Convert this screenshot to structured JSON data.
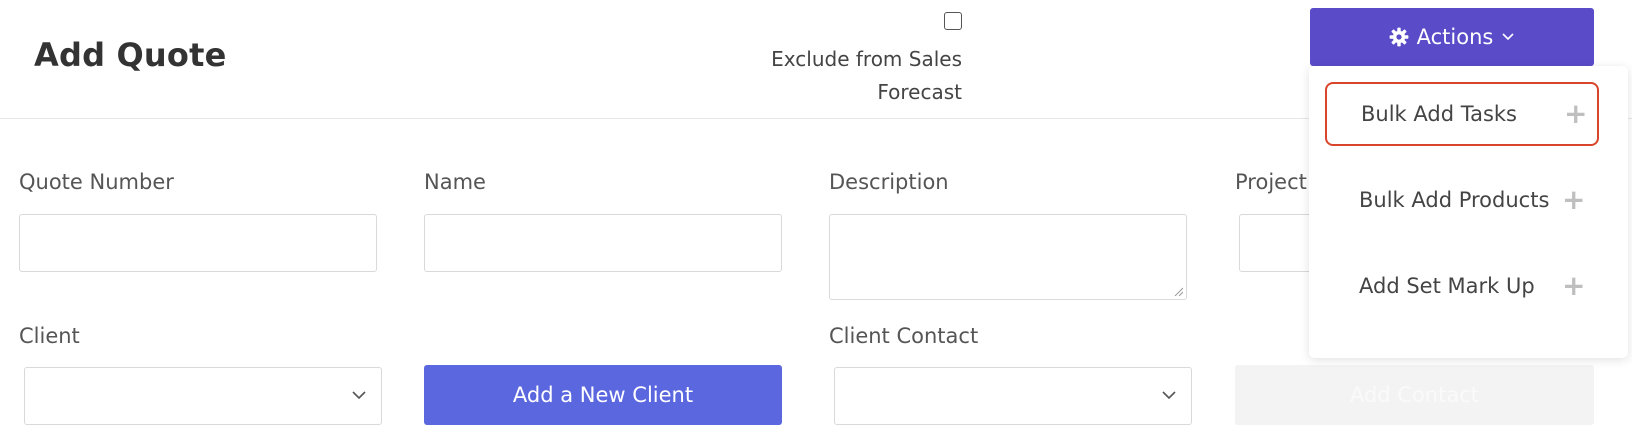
{
  "header": {
    "title": "Add Quote",
    "exclude_label": "Exclude from Sales Forecast",
    "exclude_checked": false
  },
  "actions": {
    "label": "Actions",
    "icon": "gear-icon",
    "menu_items": [
      {
        "label": "Bulk Add Tasks",
        "icon": "plus-icon",
        "highlighted": true
      },
      {
        "label": "Bulk Add Products",
        "icon": "plus-icon",
        "highlighted": false
      },
      {
        "label": "Add Set Mark Up",
        "icon": "plus-icon",
        "highlighted": false
      }
    ]
  },
  "form": {
    "quote_number_label": "Quote Number",
    "quote_number_value": "",
    "name_label": "Name",
    "name_value": "",
    "description_label": "Description",
    "description_value": "",
    "project_label": "Project",
    "client_label": "Client",
    "client_selected": "",
    "client_contact_label": "Client Contact",
    "client_contact_selected": "",
    "add_client_label": "Add a New Client",
    "add_contact_label": "Add Contact"
  },
  "colors": {
    "actions_bg": "#5a4bc9",
    "add_client_bg": "#5b67df",
    "highlight_border": "#d9452b",
    "disabled_bg": "#f3f3f3"
  }
}
